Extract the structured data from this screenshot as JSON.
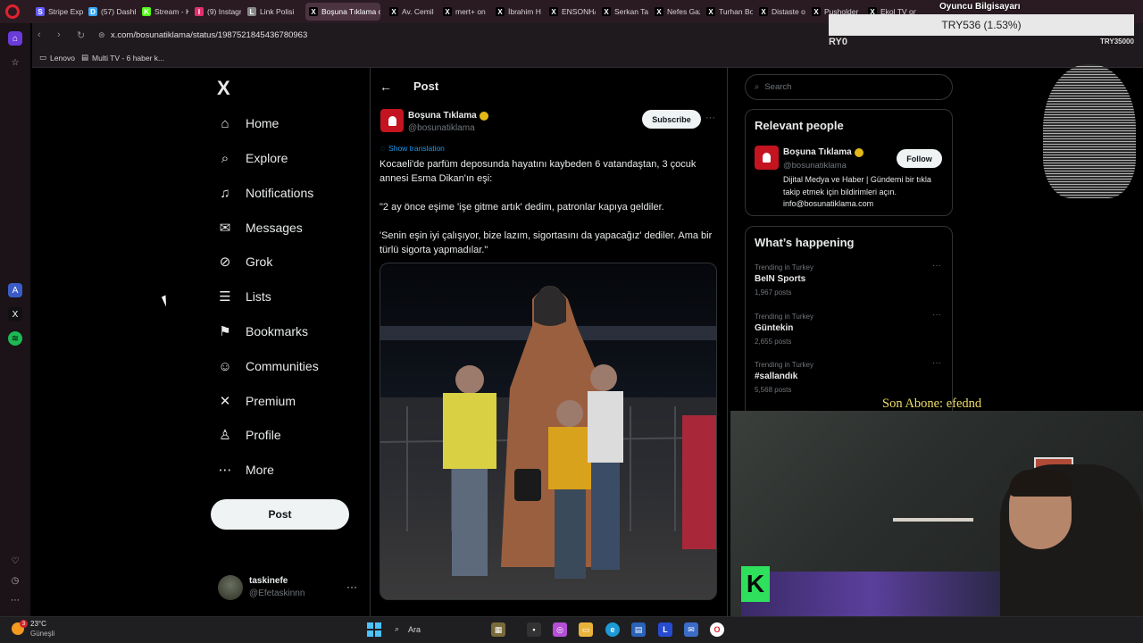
{
  "browser": {
    "tabs": [
      {
        "label": "Stripe Expr",
        "color": "#635bff",
        "glyph": "S"
      },
      {
        "label": "(57) Dashb",
        "color": "#3aa8ff",
        "glyph": "D"
      },
      {
        "label": "Stream - K",
        "color": "#53fc18",
        "glyph": "K"
      },
      {
        "label": "(9) Instagr",
        "color": "#e1306c",
        "glyph": "I"
      },
      {
        "label": "Link Polisi",
        "color": "#888888",
        "glyph": "L"
      },
      {
        "label": "Boşuna Tıklama on",
        "color": "#000000",
        "glyph": "X"
      },
      {
        "label": "Av. Cemil",
        "color": "#000000",
        "glyph": "X"
      },
      {
        "label": "mert+ on",
        "color": "#000000",
        "glyph": "X"
      },
      {
        "label": "İbrahim H",
        "color": "#000000",
        "glyph": "X"
      },
      {
        "label": "ENSONHA",
        "color": "#000000",
        "glyph": "X"
      },
      {
        "label": "Serkan Tar",
        "color": "#000000",
        "glyph": "X"
      },
      {
        "label": "Nefes Gaz",
        "color": "#000000",
        "glyph": "X"
      },
      {
        "label": "Turhan Bo",
        "color": "#000000",
        "glyph": "X"
      },
      {
        "label": "Distaste or",
        "color": "#000000",
        "glyph": "X"
      },
      {
        "label": "Pusholder",
        "color": "#000000",
        "glyph": "X"
      },
      {
        "label": "Ekol TV on",
        "color": "#000000",
        "glyph": "X"
      }
    ],
    "url": "x.com/bosunatiklama/status/1987521845436780963",
    "bookmarks": [
      "Lenovo",
      "Multi TV - 6 haber k..."
    ]
  },
  "nav": {
    "logo": "X",
    "items": [
      {
        "label": "Home",
        "icon": "home-icon",
        "glyph": "⌂"
      },
      {
        "label": "Explore",
        "icon": "search-icon",
        "glyph": "⌕"
      },
      {
        "label": "Notifications",
        "icon": "bell-icon",
        "glyph": "♫"
      },
      {
        "label": "Messages",
        "icon": "envelope-icon",
        "glyph": "✉"
      },
      {
        "label": "Grok",
        "icon": "grok-icon",
        "glyph": "⊘"
      },
      {
        "label": "Lists",
        "icon": "list-icon",
        "glyph": "☰"
      },
      {
        "label": "Bookmarks",
        "icon": "bookmark-icon",
        "glyph": "⚑"
      },
      {
        "label": "Communities",
        "icon": "people-icon",
        "glyph": "☺"
      },
      {
        "label": "Premium",
        "icon": "x-premium-icon",
        "glyph": "✕"
      },
      {
        "label": "Profile",
        "icon": "person-icon",
        "glyph": "♙"
      },
      {
        "label": "More",
        "icon": "more-circle-icon",
        "glyph": "⋯"
      }
    ],
    "post_button": "Post",
    "account": {
      "name": "taskinefe",
      "handle": "@Efetaskinnn"
    }
  },
  "post": {
    "header": "Post",
    "author_name": "Boşuna Tıklama",
    "author_handle": "@bosunatiklama",
    "subscribe": "Subscribe",
    "show_translation": "Show translation",
    "paragraphs": [
      "Kocaeli'de parfüm deposunda hayatını kaybeden 6 vatandaştan, 3 çocuk annesi Esma Dikan'ın eşi:",
      "\"2 ay önce eşime 'işe gitme artık' dedim, patronlar kapıya geldiler.",
      "'Senin eşin iyi çalışıyor, bize lazım, sigortasını da yapacağız' dediler. Ama bir türlü sigorta yapmadılar.\""
    ]
  },
  "sidebar": {
    "search_placeholder": "Search",
    "relevant_title": "Relevant people",
    "person": {
      "name": "Boşuna Tıklama",
      "handle": "@bosunatiklama",
      "follow": "Follow",
      "bio": "Dijital Medya ve Haber | Gündemi bir tıkla takip etmek için bildirimleri açın. info@bosunatiklama.com"
    },
    "happening_title": "What’s happening",
    "trends": [
      {
        "category": "Trending in Turkey",
        "name": "BeIN Sports",
        "posts": "1,967 posts"
      },
      {
        "category": "Trending in Turkey",
        "name": "Güntekin",
        "posts": "2,655 posts"
      },
      {
        "category": "Trending in Turkey",
        "name": "#sallandık",
        "posts": "5,568 posts"
      }
    ]
  },
  "overlay": {
    "streamer_label": "Oyuncu Bilgisayarı",
    "ticker": "TRY536 (1.53%)",
    "ticker_left": "RY0",
    "ticker_right": "TRY35000",
    "last_subscriber": "Son Abone: efednd"
  },
  "taskbar": {
    "temperature": "23°C",
    "condition": "Güneşli",
    "weather_badge": "3",
    "search": "Ara"
  }
}
